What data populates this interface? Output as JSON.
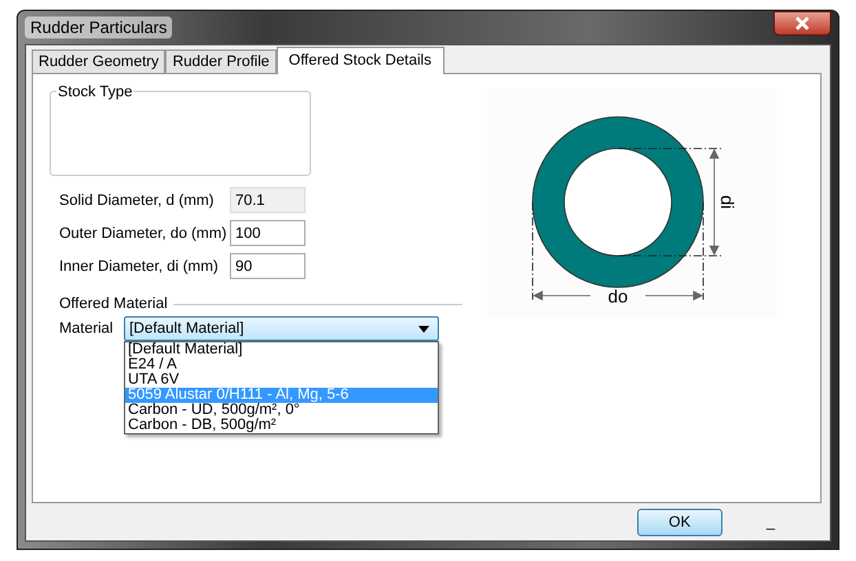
{
  "window": {
    "title": "Rudder Particulars"
  },
  "tabs": [
    {
      "label": "Rudder Geometry",
      "selected": false
    },
    {
      "label": "Rudder Profile",
      "selected": false
    },
    {
      "label": "Offered Stock Details",
      "selected": true
    }
  ],
  "stock_type": {
    "title": "Stock Type"
  },
  "fields": [
    {
      "label": "Solid Diameter, d (mm)",
      "value": "70.1",
      "disabled": true
    },
    {
      "label": "Outer Diameter, do (mm)",
      "value": "100",
      "disabled": false
    },
    {
      "label": "Inner Diameter, di (mm)",
      "value": "90",
      "disabled": false
    }
  ],
  "diagram": {
    "inner_label": "di",
    "outer_label": "do"
  },
  "offered_material": {
    "title": "Offered Material",
    "label": "Material",
    "value": "[Default Material]",
    "options": [
      {
        "label": "[Default Material]",
        "highlighted": false
      },
      {
        "label": "E24 / A",
        "highlighted": false
      },
      {
        "label": "UTA 6V",
        "highlighted": false
      },
      {
        "label": "5059 Alustar 0/H111 - Al, Mg, 5-6",
        "highlighted": true
      },
      {
        "label": "Carbon - UD, 500g/m², 0°",
        "highlighted": false
      },
      {
        "label": "Carbon - DB, 500g/m²",
        "highlighted": false
      }
    ]
  },
  "buttons": [
    {
      "label": "OK"
    }
  ],
  "footer_mark": "_"
}
